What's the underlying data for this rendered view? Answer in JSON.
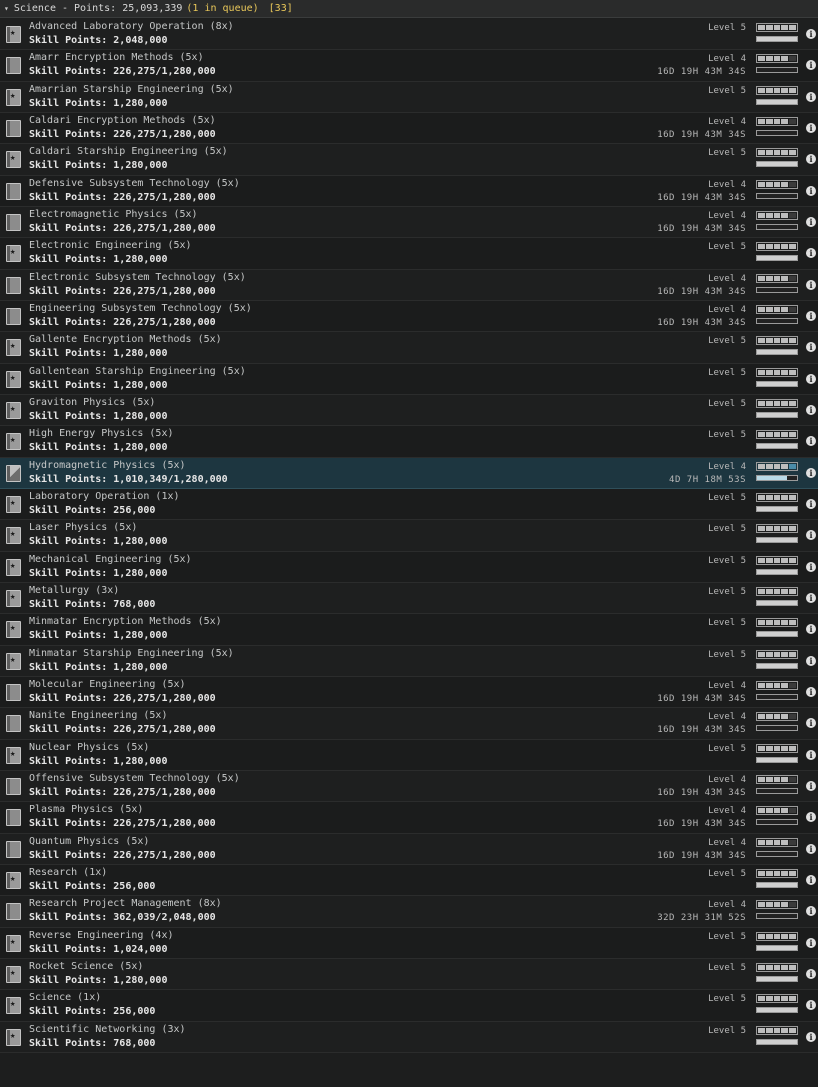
{
  "header": {
    "caret": "▾",
    "title": "Science - Points: 25,093,339",
    "queue": "(1 in queue)",
    "count": "[33]"
  },
  "skills": [
    {
      "name": "Advanced Laboratory Operation (8x)",
      "points": "Skill Points: 2,048,000",
      "level": "Level 5",
      "time": "",
      "pips": 5,
      "progress": 1.0,
      "state": "complete"
    },
    {
      "name": "Amarr Encryption Methods (5x)",
      "points": "Skill Points: 226,275/1,280,000",
      "level": "Level 4",
      "time": "16D 19H 43M 34S",
      "pips": 4,
      "progress": 0.0,
      "state": "partial"
    },
    {
      "name": "Amarrian Starship Engineering (5x)",
      "points": "Skill Points: 1,280,000",
      "level": "Level 5",
      "time": "",
      "pips": 5,
      "progress": 1.0,
      "state": "complete"
    },
    {
      "name": "Caldari Encryption Methods (5x)",
      "points": "Skill Points: 226,275/1,280,000",
      "level": "Level 4",
      "time": "16D 19H 43M 34S",
      "pips": 4,
      "progress": 0.0,
      "state": "partial"
    },
    {
      "name": "Caldari Starship Engineering (5x)",
      "points": "Skill Points: 1,280,000",
      "level": "Level 5",
      "time": "",
      "pips": 5,
      "progress": 1.0,
      "state": "complete"
    },
    {
      "name": "Defensive Subsystem Technology (5x)",
      "points": "Skill Points: 226,275/1,280,000",
      "level": "Level 4",
      "time": "16D 19H 43M 34S",
      "pips": 4,
      "progress": 0.0,
      "state": "partial"
    },
    {
      "name": "Electromagnetic Physics (5x)",
      "points": "Skill Points: 226,275/1,280,000",
      "level": "Level 4",
      "time": "16D 19H 43M 34S",
      "pips": 4,
      "progress": 0.0,
      "state": "partial"
    },
    {
      "name": "Electronic Engineering (5x)",
      "points": "Skill Points: 1,280,000",
      "level": "Level 5",
      "time": "",
      "pips": 5,
      "progress": 1.0,
      "state": "complete"
    },
    {
      "name": "Electronic Subsystem Technology (5x)",
      "points": "Skill Points: 226,275/1,280,000",
      "level": "Level 4",
      "time": "16D 19H 43M 34S",
      "pips": 4,
      "progress": 0.0,
      "state": "partial"
    },
    {
      "name": "Engineering Subsystem Technology (5x)",
      "points": "Skill Points: 226,275/1,280,000",
      "level": "Level 4",
      "time": "16D 19H 43M 34S",
      "pips": 4,
      "progress": 0.0,
      "state": "partial"
    },
    {
      "name": "Gallente Encryption Methods (5x)",
      "points": "Skill Points: 1,280,000",
      "level": "Level 5",
      "time": "",
      "pips": 5,
      "progress": 1.0,
      "state": "complete"
    },
    {
      "name": "Gallentean Starship Engineering (5x)",
      "points": "Skill Points: 1,280,000",
      "level": "Level 5",
      "time": "",
      "pips": 5,
      "progress": 1.0,
      "state": "complete"
    },
    {
      "name": "Graviton Physics (5x)",
      "points": "Skill Points: 1,280,000",
      "level": "Level 5",
      "time": "",
      "pips": 5,
      "progress": 1.0,
      "state": "complete"
    },
    {
      "name": "High Energy Physics (5x)",
      "points": "Skill Points: 1,280,000",
      "level": "Level 5",
      "time": "",
      "pips": 5,
      "progress": 1.0,
      "state": "complete"
    },
    {
      "name": "Hydromagnetic Physics (5x)",
      "points": "Skill Points: 1,010,349/1,280,000",
      "level": "Level 4",
      "time": "4D 7H 18M 53S",
      "pips": 4,
      "progress": 0.75,
      "state": "training"
    },
    {
      "name": "Laboratory Operation (1x)",
      "points": "Skill Points: 256,000",
      "level": "Level 5",
      "time": "",
      "pips": 5,
      "progress": 1.0,
      "state": "complete"
    },
    {
      "name": "Laser Physics (5x)",
      "points": "Skill Points: 1,280,000",
      "level": "Level 5",
      "time": "",
      "pips": 5,
      "progress": 1.0,
      "state": "complete"
    },
    {
      "name": "Mechanical Engineering (5x)",
      "points": "Skill Points: 1,280,000",
      "level": "Level 5",
      "time": "",
      "pips": 5,
      "progress": 1.0,
      "state": "complete"
    },
    {
      "name": "Metallurgy (3x)",
      "points": "Skill Points: 768,000",
      "level": "Level 5",
      "time": "",
      "pips": 5,
      "progress": 1.0,
      "state": "complete"
    },
    {
      "name": "Minmatar Encryption Methods (5x)",
      "points": "Skill Points: 1,280,000",
      "level": "Level 5",
      "time": "",
      "pips": 5,
      "progress": 1.0,
      "state": "complete"
    },
    {
      "name": "Minmatar Starship Engineering (5x)",
      "points": "Skill Points: 1,280,000",
      "level": "Level 5",
      "time": "",
      "pips": 5,
      "progress": 1.0,
      "state": "complete"
    },
    {
      "name": "Molecular Engineering (5x)",
      "points": "Skill Points: 226,275/1,280,000",
      "level": "Level 4",
      "time": "16D 19H 43M 34S",
      "pips": 4,
      "progress": 0.0,
      "state": "partial"
    },
    {
      "name": "Nanite Engineering (5x)",
      "points": "Skill Points: 226,275/1,280,000",
      "level": "Level 4",
      "time": "16D 19H 43M 34S",
      "pips": 4,
      "progress": 0.0,
      "state": "partial"
    },
    {
      "name": "Nuclear Physics (5x)",
      "points": "Skill Points: 1,280,000",
      "level": "Level 5",
      "time": "",
      "pips": 5,
      "progress": 1.0,
      "state": "complete"
    },
    {
      "name": "Offensive Subsystem Technology (5x)",
      "points": "Skill Points: 226,275/1,280,000",
      "level": "Level 4",
      "time": "16D 19H 43M 34S",
      "pips": 4,
      "progress": 0.0,
      "state": "partial"
    },
    {
      "name": "Plasma Physics (5x)",
      "points": "Skill Points: 226,275/1,280,000",
      "level": "Level 4",
      "time": "16D 19H 43M 34S",
      "pips": 4,
      "progress": 0.0,
      "state": "partial"
    },
    {
      "name": "Quantum Physics (5x)",
      "points": "Skill Points: 226,275/1,280,000",
      "level": "Level 4",
      "time": "16D 19H 43M 34S",
      "pips": 4,
      "progress": 0.0,
      "state": "partial"
    },
    {
      "name": "Research (1x)",
      "points": "Skill Points: 256,000",
      "level": "Level 5",
      "time": "",
      "pips": 5,
      "progress": 1.0,
      "state": "complete"
    },
    {
      "name": "Research Project Management (8x)",
      "points": "Skill Points: 362,039/2,048,000",
      "level": "Level 4",
      "time": "32D 23H 31M 52S",
      "pips": 4,
      "progress": 0.0,
      "state": "partial"
    },
    {
      "name": "Reverse Engineering (4x)",
      "points": "Skill Points: 1,024,000",
      "level": "Level 5",
      "time": "",
      "pips": 5,
      "progress": 1.0,
      "state": "complete"
    },
    {
      "name": "Rocket Science (5x)",
      "points": "Skill Points: 1,280,000",
      "level": "Level 5",
      "time": "",
      "pips": 5,
      "progress": 1.0,
      "state": "complete"
    },
    {
      "name": "Science (1x)",
      "points": "Skill Points: 256,000",
      "level": "Level 5",
      "time": "",
      "pips": 5,
      "progress": 1.0,
      "state": "complete"
    },
    {
      "name": "Scientific Networking (3x)",
      "points": "Skill Points: 768,000",
      "level": "Level 5",
      "time": "",
      "pips": 5,
      "progress": 1.0,
      "state": "complete"
    }
  ],
  "icons": {
    "info": "info-icon",
    "book": "skillbook-icon"
  },
  "colors": {
    "accent": "#e9c85a",
    "training": "#4b8ca8",
    "active_row": "#1d3640"
  }
}
